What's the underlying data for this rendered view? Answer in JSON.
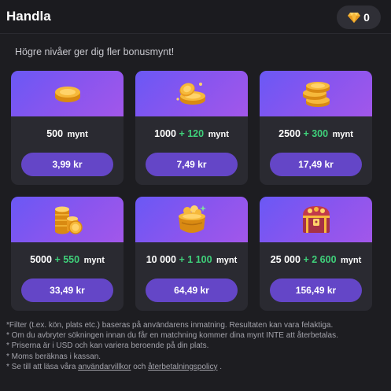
{
  "header": {
    "title": "Handla",
    "gem_count": "0"
  },
  "subtitle": "Högre nivåer ger dig fler bonusmynt!",
  "packages": [
    {
      "base": "500",
      "plus": "",
      "bonus": "",
      "unit": "mynt",
      "price": "3,99 kr",
      "icon": "single-coin-icon"
    },
    {
      "base": "1000",
      "plus": "+",
      "bonus": "120",
      "unit": "mynt",
      "price": "7,49 kr",
      "icon": "coin-pair-icon"
    },
    {
      "base": "2500",
      "plus": "+",
      "bonus": "300",
      "unit": "mynt",
      "price": "17,49 kr",
      "icon": "coin-stack-icon"
    },
    {
      "base": "5000",
      "plus": "+",
      "bonus": "550",
      "unit": "mynt",
      "price": "33,49 kr",
      "icon": "coin-pile-icon"
    },
    {
      "base": "10 000",
      "plus": "+",
      "bonus": "1 100",
      "unit": "mynt",
      "price": "64,49 kr",
      "icon": "coin-pot-icon"
    },
    {
      "base": "25 000",
      "plus": "+",
      "bonus": "2 600",
      "unit": "mynt",
      "price": "156,49 kr",
      "icon": "treasure-chest-icon"
    }
  ],
  "footnotes": {
    "line1": "*Filter (t.ex. kön, plats etc.) baseras på användarens inmatning. Resultaten kan vara felaktiga.",
    "line2": "* Om du avbryter sökningen innan du får en matchning kommer dina mynt INTE att återbetalas.",
    "line3": "* Priserna är i USD och kan variera beroende på din plats.",
    "line4": "* Moms beräknas i kassan.",
    "line5_prefix": "* Se till att läsa våra",
    "terms_link": "användarvillkor",
    "line5_mid": "och",
    "refund_link": "återbetalningspolicy",
    "line5_suffix": "."
  },
  "colors": {
    "background": "#1d1d21",
    "card": "#2a2a31",
    "price_button": "#6446c7",
    "bonus_green": "#3fd07a",
    "gradient_start": "#6a58f5",
    "gradient_end": "#a257ea",
    "coin_gold": "#f6b93b"
  }
}
